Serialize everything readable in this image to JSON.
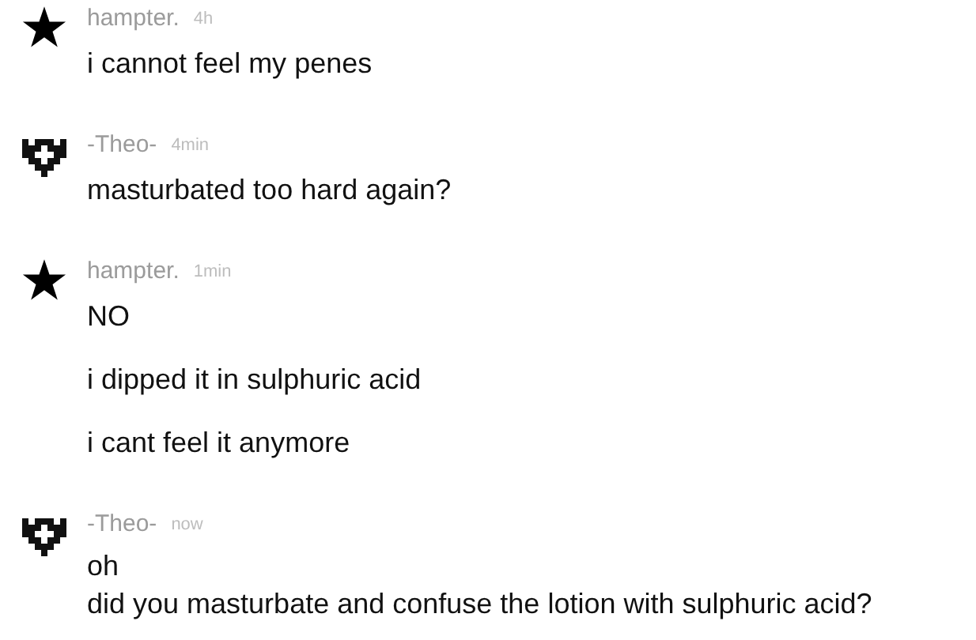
{
  "groups": [
    {
      "avatar": {
        "kind": "star"
      },
      "name": "hampter.",
      "time": "4h",
      "messages": [
        {
          "lines": [
            "i cannot feel my penes"
          ]
        }
      ]
    },
    {
      "avatar": {
        "kind": "pixel"
      },
      "name": "-Theo-",
      "time": "4min",
      "messages": [
        {
          "lines": [
            "masturbated too hard again?"
          ]
        }
      ]
    },
    {
      "avatar": {
        "kind": "star"
      },
      "name": "hampter.",
      "time": "1min",
      "messages": [
        {
          "lines": [
            "NO"
          ]
        },
        {
          "lines": [
            "i dipped it in sulphuric acid"
          ]
        },
        {
          "lines": [
            "i cant feel it anymore"
          ]
        }
      ]
    },
    {
      "avatar": {
        "kind": "pixel"
      },
      "name": "-Theo-",
      "time": "now",
      "messages": [
        {
          "lines": [
            "oh",
            "did you masturbate and confuse the lotion with sulphuric acid?"
          ]
        }
      ]
    }
  ]
}
